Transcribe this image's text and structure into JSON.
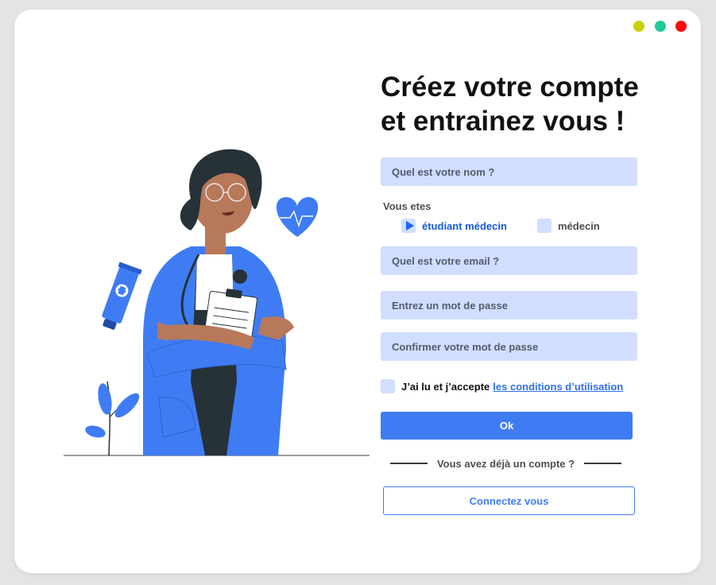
{
  "window": {
    "controls": [
      "minimize-dot",
      "maximize-dot",
      "close-dot"
    ],
    "control_colors": {
      "yellow": "#c8d20a",
      "green": "#1ec99a",
      "red": "#ff0b0b"
    }
  },
  "title": {
    "line1": "Créez votre compte",
    "line2": "et entrainez vous !"
  },
  "form": {
    "name_placeholder": "Quel est votre nom ?",
    "role": {
      "label": "Vous etes",
      "options": [
        {
          "label": "étudiant médecin",
          "selected": true
        },
        {
          "label": "médecin",
          "selected": false
        }
      ]
    },
    "email_placeholder": "Quel est votre email ?",
    "password_placeholder": "Entrez un mot de passe",
    "confirm_placeholder": "Confirmer votre mot de passe",
    "terms": {
      "text": "J’ai lu et j’accepte",
      "link": "les conditions d’utilisation",
      "checked": false
    },
    "submit_label": "Ok"
  },
  "login": {
    "divider_text": "Vous avez déjà un compte ?",
    "button_label": "Connectez vous"
  },
  "colors": {
    "accent": "#3f7cf4",
    "field_bg": "#d1deff",
    "selected_text": "#1659e0"
  },
  "illustration": {
    "icons": [
      "doctor-illustration",
      "heart-icon",
      "ointment-tube-icon",
      "plant-icon"
    ]
  }
}
